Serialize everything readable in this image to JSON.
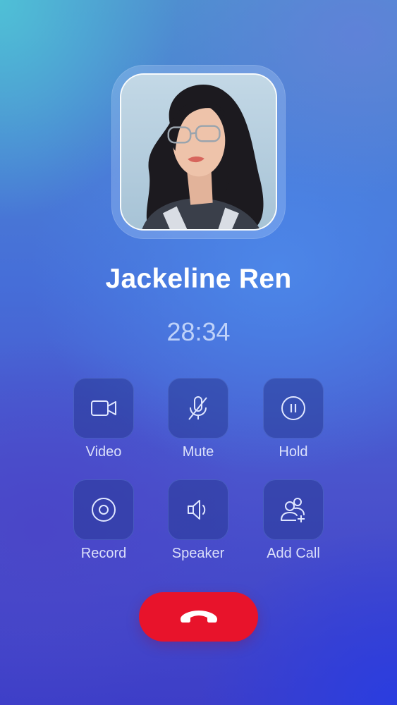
{
  "contact": {
    "name": "Jackeline Ren",
    "duration": "28:34"
  },
  "controls": [
    {
      "label": "Video",
      "icon": "video-camera-icon"
    },
    {
      "label": "Mute",
      "icon": "microphone-off-icon"
    },
    {
      "label": "Hold",
      "icon": "pause-icon"
    },
    {
      "label": "Record",
      "icon": "record-icon"
    },
    {
      "label": "Speaker",
      "icon": "speaker-icon"
    },
    {
      "label": "Add Call",
      "icon": "add-user-icon"
    }
  ],
  "end_call": {
    "icon": "hang-up-icon",
    "color": "#e8132b"
  },
  "colors": {
    "background_top": "#4fc0d6",
    "background_bottom": "#2a3de0",
    "control_bg": "#283a96"
  }
}
